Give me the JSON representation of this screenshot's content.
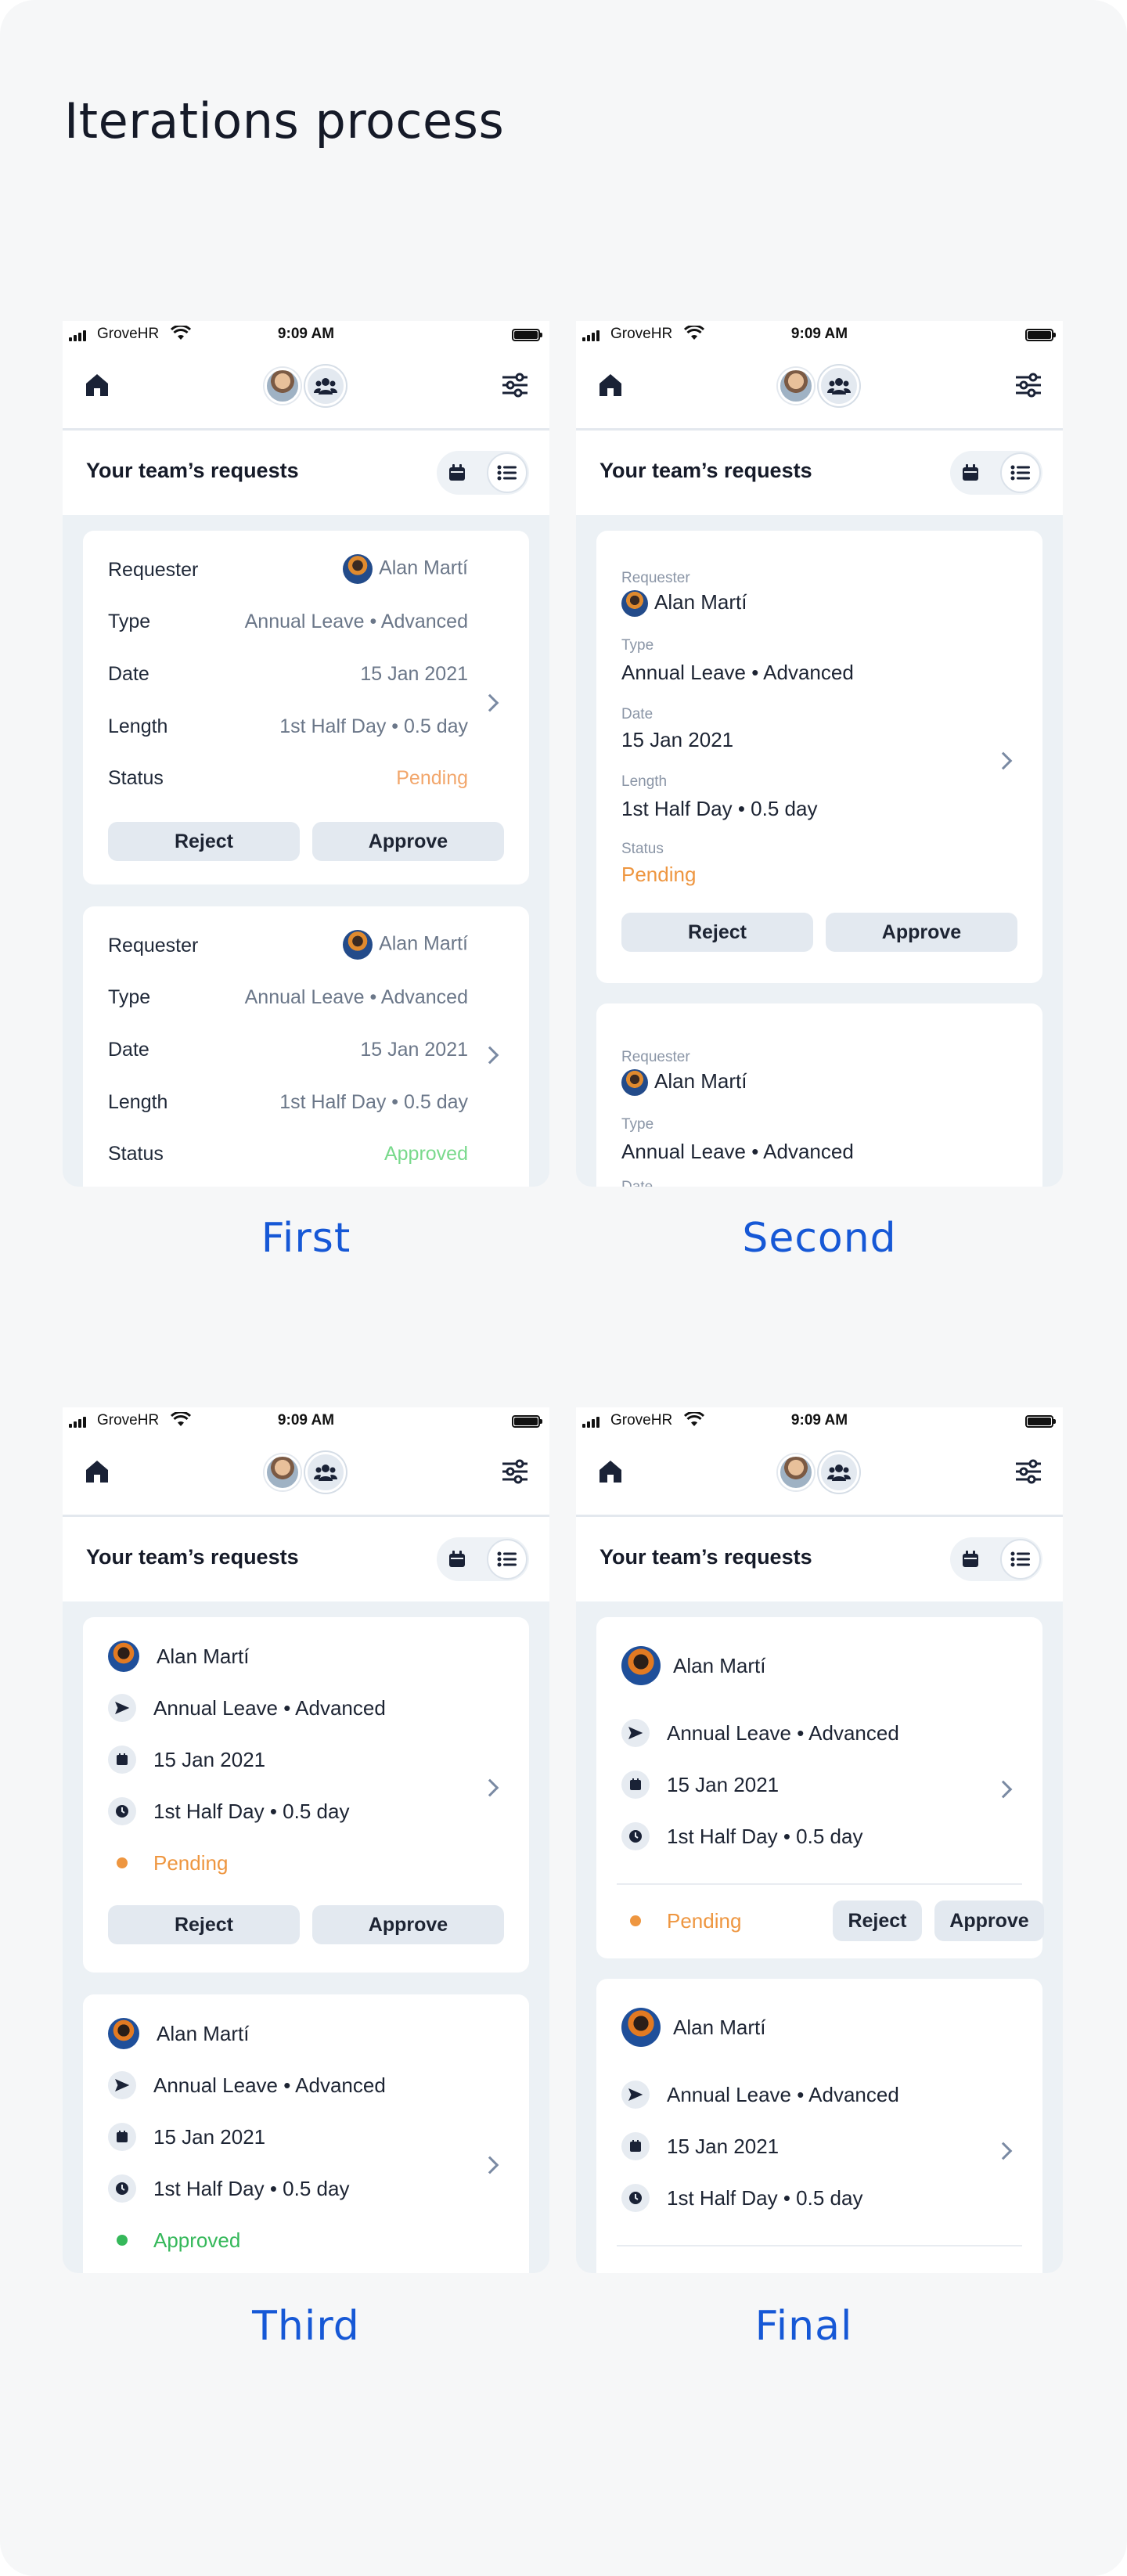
{
  "page": {
    "title": "Iterations process"
  },
  "phone": {
    "carrier": "GroveHR",
    "time": "9:09 AM",
    "subheader_title": "Your team’s requests"
  },
  "labels": {
    "requester": "Requester",
    "type": "Type",
    "date": "Date",
    "length": "Length",
    "status": "Status",
    "date_cut": "Date",
    "reject": "Reject",
    "approve": "Approve"
  },
  "request": {
    "name": "Alan Martí",
    "type": "Annual Leave • Advanced",
    "date": "15 Jan 2021",
    "length": "1st Half Day • 0.5 day"
  },
  "statuses": {
    "pending": "Pending",
    "approved": "Approved"
  },
  "captions": {
    "first": "First",
    "second": "Second",
    "third": "Third",
    "final": "Final"
  },
  "colors": {
    "accent": "#1658d6",
    "pending": "#ee9640",
    "approved": "#35b85a",
    "background": "#ecf1f5"
  },
  "icons": [
    "home-icon",
    "team-icon",
    "filter-icon",
    "calendar-icon",
    "list-icon",
    "chevron-right-icon",
    "plane-icon",
    "clock-icon",
    "wifi-icon"
  ]
}
